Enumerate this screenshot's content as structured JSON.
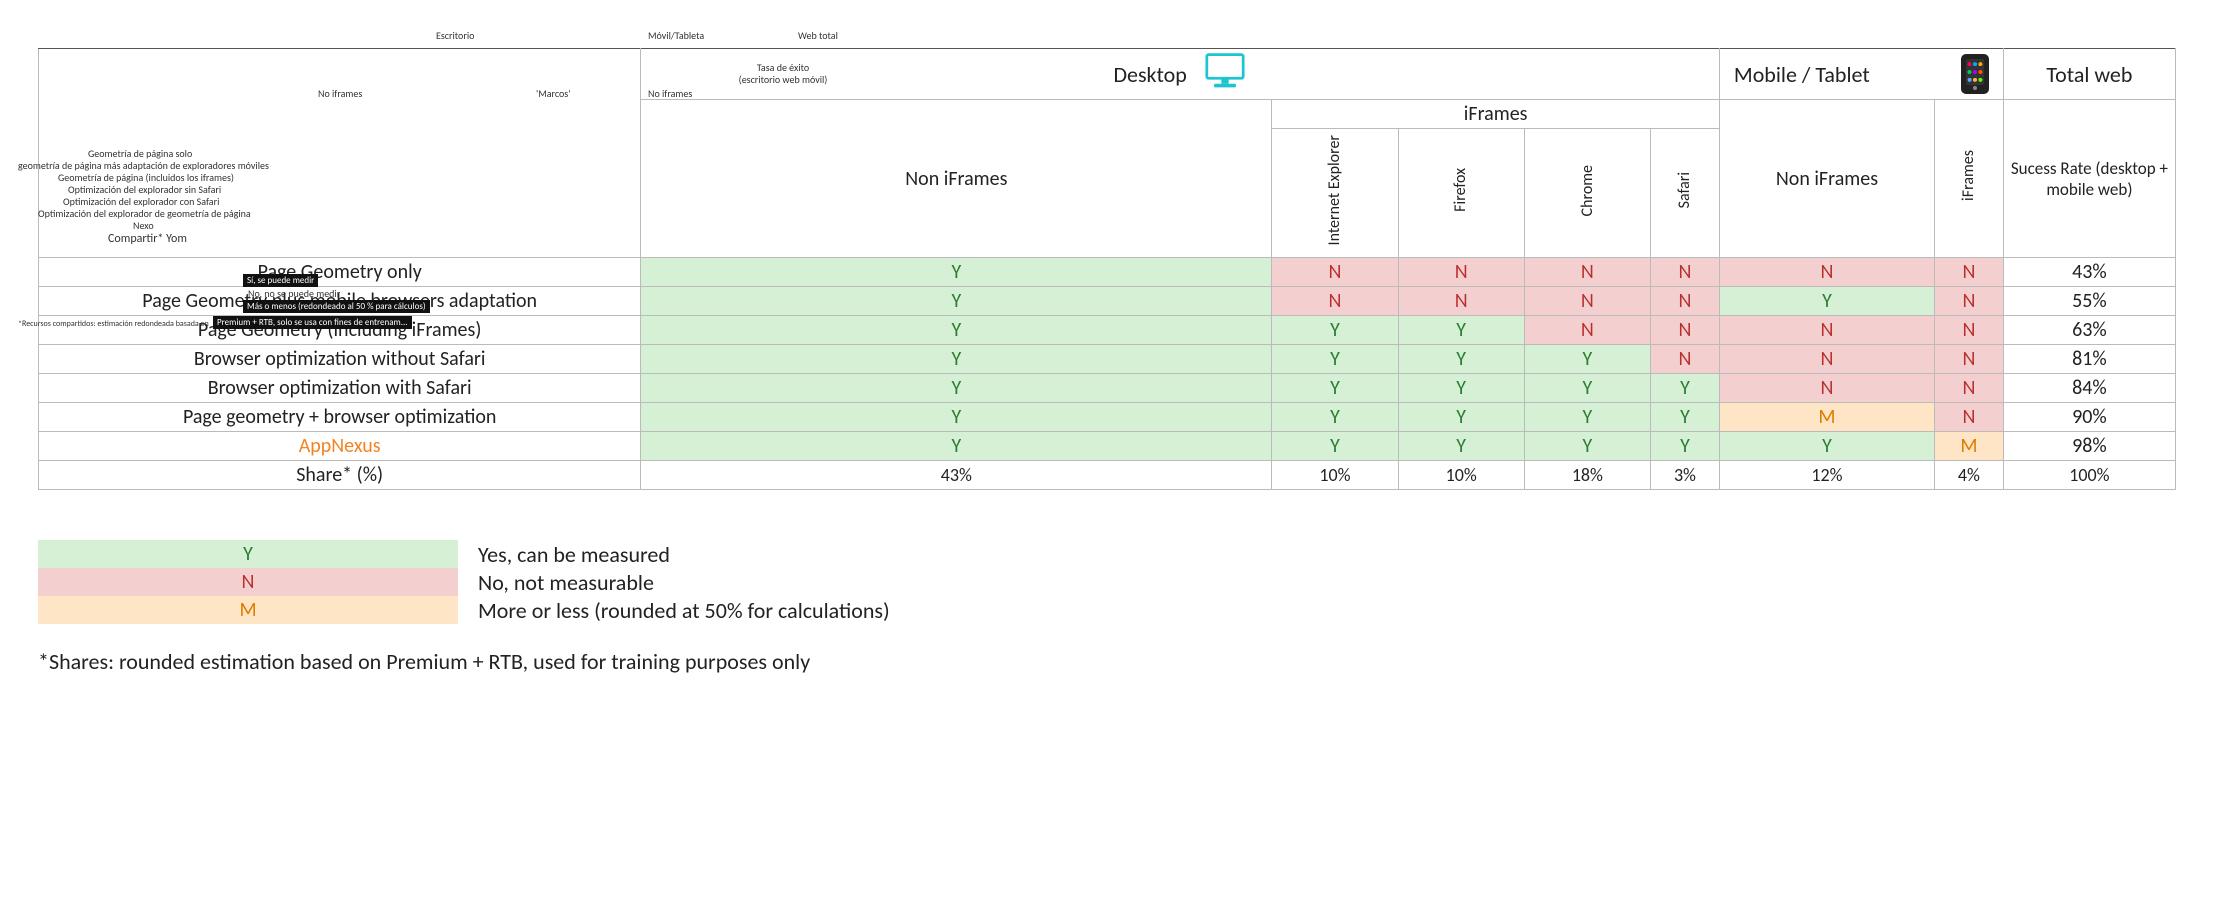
{
  "ghost": {
    "escritorio": "Escritorio",
    "movil_tableta": "Móvil/Tableta",
    "web_total": "Web total",
    "tasa": "Tasa de éxito (escritorio web móvil)",
    "no_frames_left": "No iframes",
    "marcos": "'Marcos'",
    "no_frames_mid": "No iframes",
    "es_rows": [
      "Geometría de página solo",
      "geometría de página más adaptación de exploradores móviles",
      "Geometría de página (incluidos los iframes)",
      "Optimización del explorador sin Safari",
      "Optimización del explorador con Safari",
      "Optimización del explorador de geometría de página",
      "Nexo",
      "Compartir* Yom"
    ],
    "bars": [
      "Sí, se puede medir",
      "No, no se puede medir",
      "Más o menos (redondeado al 50 % para cálculos)",
      "Premium + RTB, solo se usa con fines de entrenam..."
    ],
    "shares_prefix": "*Recursos compartidos: estimación redondeada basada en"
  },
  "headers": {
    "desktop": "Desktop",
    "mobile": "Mobile / Tablet",
    "total_web": "Total web",
    "non_iframes": "Non iFrames",
    "iframes": "iFrames",
    "success_rate": "Sucess Rate (desktop + mobile web)",
    "browsers": {
      "ie": "Internet Explorer",
      "ff": "Firefox",
      "ch": "Chrome",
      "sf": "Safari"
    }
  },
  "chart_data": {
    "type": "table",
    "columns": [
      "Desktop Non iFrames",
      "Desktop iFrames – Internet Explorer",
      "Desktop iFrames – Firefox",
      "Desktop iFrames – Chrome",
      "Desktop iFrames – Safari",
      "Mobile/Tablet Non iFrames",
      "Mobile/Tablet iFrames",
      "Success Rate (%)"
    ],
    "value_legend": {
      "Y": "Yes, can be measured",
      "N": "No, not measurable",
      "M": "More or less (rounded at 50% for calculations)"
    },
    "rows": [
      {
        "label": "Page Geometry only",
        "cells": [
          "Y",
          "N",
          "N",
          "N",
          "N",
          "N",
          "N"
        ],
        "pct": 43
      },
      {
        "label": "Page Geometry plus mobile browsers adaptation",
        "cells": [
          "Y",
          "N",
          "N",
          "N",
          "N",
          "Y",
          "N"
        ],
        "pct": 55
      },
      {
        "label": "Page Geometry (including iFrames)",
        "cells": [
          "Y",
          "Y",
          "Y",
          "N",
          "N",
          "N",
          "N"
        ],
        "pct": 63
      },
      {
        "label": "Browser optimization without Safari",
        "cells": [
          "Y",
          "Y",
          "Y",
          "Y",
          "N",
          "N",
          "N"
        ],
        "pct": 81
      },
      {
        "label": "Browser optimization with Safari",
        "cells": [
          "Y",
          "Y",
          "Y",
          "Y",
          "Y",
          "N",
          "N"
        ],
        "pct": 84
      },
      {
        "label": "Page geometry + browser optimization",
        "cells": [
          "Y",
          "Y",
          "Y",
          "Y",
          "Y",
          "M",
          "N"
        ],
        "pct": 90
      },
      {
        "label": "AppNexus",
        "brand": true,
        "cells": [
          "Y",
          "Y",
          "Y",
          "Y",
          "Y",
          "Y",
          "M"
        ],
        "pct": 98
      }
    ],
    "share_label": "Share* (%)",
    "share": [
      "43%",
      "10%",
      "10%",
      "18%",
      "3%",
      "12%",
      "4%",
      "100%"
    ]
  },
  "legend": {
    "y": {
      "sym": "Y",
      "text": "Yes, can be measured"
    },
    "n": {
      "sym": "N",
      "text": "No, not measurable"
    },
    "m": {
      "sym": "M",
      "text": "More or less (rounded at 50% for calculations)"
    }
  },
  "footnote": "*Shares: rounded estimation based on Premium + RTB, used for training purposes only"
}
